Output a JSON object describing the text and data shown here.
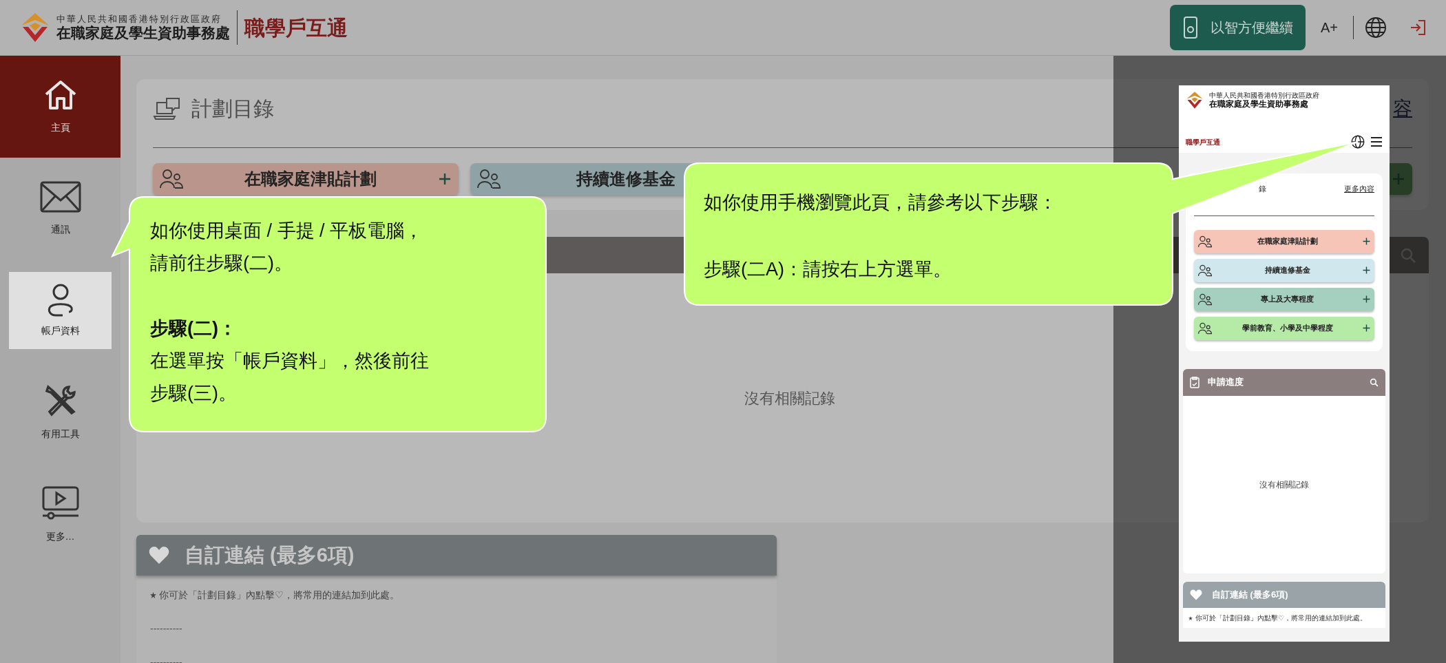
{
  "header": {
    "agency_line1": "中華人民共和國香港特別行政區政府",
    "agency_line2": "在職家庭及學生資助事務處",
    "app_name": "職學戶互通",
    "continue_button": "以智方便繼續",
    "font_size_button": "A+"
  },
  "sidebar": {
    "items": [
      {
        "label": "主頁",
        "selected": true,
        "highlighted": false
      },
      {
        "label": "通訊",
        "selected": false,
        "highlighted": false
      },
      {
        "label": "帳戶資料",
        "selected": false,
        "highlighted": true
      },
      {
        "label": "有用工具",
        "selected": false,
        "highlighted": false
      },
      {
        "label": "更多…",
        "selected": false,
        "highlighted": false
      }
    ]
  },
  "programme_catalogue": {
    "title": "計劃目錄",
    "more_link": "容",
    "schemes": [
      {
        "kind": "full",
        "label": "在職家庭津貼計劃",
        "color": "#b9958b"
      },
      {
        "kind": "label-only",
        "label": "持續進修基金",
        "color": "#8fa2a6"
      },
      {
        "kind": "plus-only"
      }
    ]
  },
  "application_progress": {
    "empty_text": "沒有相關記錄"
  },
  "custom_links": {
    "title": "自訂連結 (最多6項)",
    "hint": "你可於「計劃目錄」內點擊♡，將常用的連結加到此處。",
    "slots": [
      "----------",
      "----------"
    ]
  },
  "mobile_preview": {
    "agency_line1": "中華人民共和國香港特別行政區政府",
    "agency_line2": "在職家庭及學生資助事務處",
    "app_name": "職學戶互通",
    "catalogue_title": "錄",
    "more_link": "更多內容",
    "schemes": [
      {
        "label": "在職家庭津貼計劃",
        "color": "#f6c5b8"
      },
      {
        "label": "持續進修基金",
        "color": "#d0e7ed"
      },
      {
        "label": "專上及大專程度",
        "color": "#a5d0c0"
      },
      {
        "label": "學前教育、小學及中學程度",
        "color": "#b6eba7"
      }
    ],
    "progress_title": "申請進度",
    "empty_text": "沒有相關記錄",
    "custom_links_title": "自訂連結 (最多6項)",
    "hint": "你可於「計劃目錄」內點擊♡，將常用的連結加到此處。"
  },
  "callouts": [
    {
      "kind": "left",
      "paragraphs": [
        [
          "如你使用桌面 / 手提 / 平板電腦，",
          "請前往步驟(二)。"
        ],
        [
          "**步驟(二)：**",
          "在選單按「帳戶資料」，然後前往",
          "步驟(三)。"
        ]
      ]
    },
    {
      "kind": "right",
      "paragraphs": [
        [
          "如你使用手機瀏覽此頁，請參考以下步驟："
        ],
        [
          "步驟(二A)：請按右上方選單。"
        ]
      ]
    }
  ]
}
